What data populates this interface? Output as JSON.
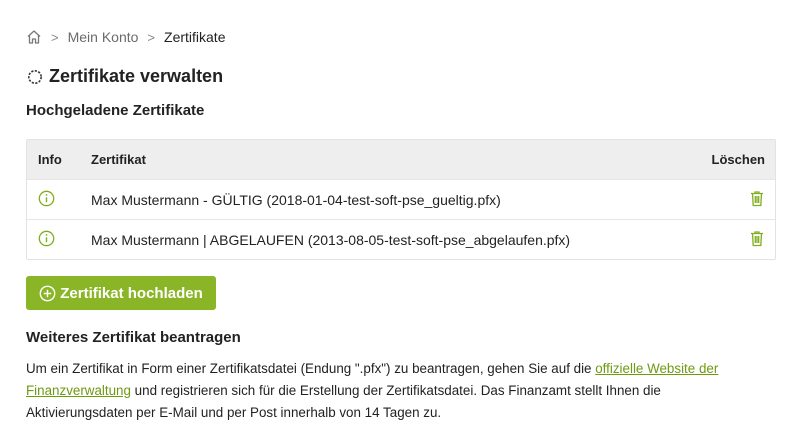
{
  "breadcrumb": {
    "home_icon": "home-icon",
    "items": [
      "Mein Konto",
      "Zertifikate"
    ],
    "separator": ">"
  },
  "page": {
    "title": "Zertifikate verwalten",
    "title_icon": "gear-icon",
    "subtitle": "Hochgeladene Zertifikate"
  },
  "table": {
    "headers": {
      "info": "Info",
      "cert": "Zertifikat",
      "delete": "Löschen"
    },
    "rows": [
      {
        "info_icon": "info-icon",
        "name": "Max Mustermann - GÜLTIG (2018-01-04-test-soft-pse_gueltig.pfx)",
        "delete_icon": "trash-icon"
      },
      {
        "info_icon": "info-icon",
        "name": "Max Mustermann | ABGELAUFEN (2013-08-05-test-soft-pse_abgelaufen.pfx)",
        "delete_icon": "trash-icon"
      }
    ]
  },
  "upload_button": {
    "label": "Zertifikat hochladen",
    "icon": "plus-circle-icon"
  },
  "request": {
    "heading": "Weiteres Zertifikat beantragen",
    "text_before": "Um ein Zertifikat in Form einer Zertifikatsdatei (Endung \".pfx\") zu beantragen, gehen Sie auf die ",
    "link_text": "offizielle Website der Finanzverwaltung",
    "text_after": " und registrieren sich für die Erstellung der Zertifikatsdatei. Das Finanzamt stellt Ihnen die Aktivierungsdaten per E-Mail und per Post innerhalb von 14 Tagen zu."
  },
  "colors": {
    "accent": "#8ab526",
    "link": "#6e9a12",
    "header_bg": "#eeeeee"
  }
}
